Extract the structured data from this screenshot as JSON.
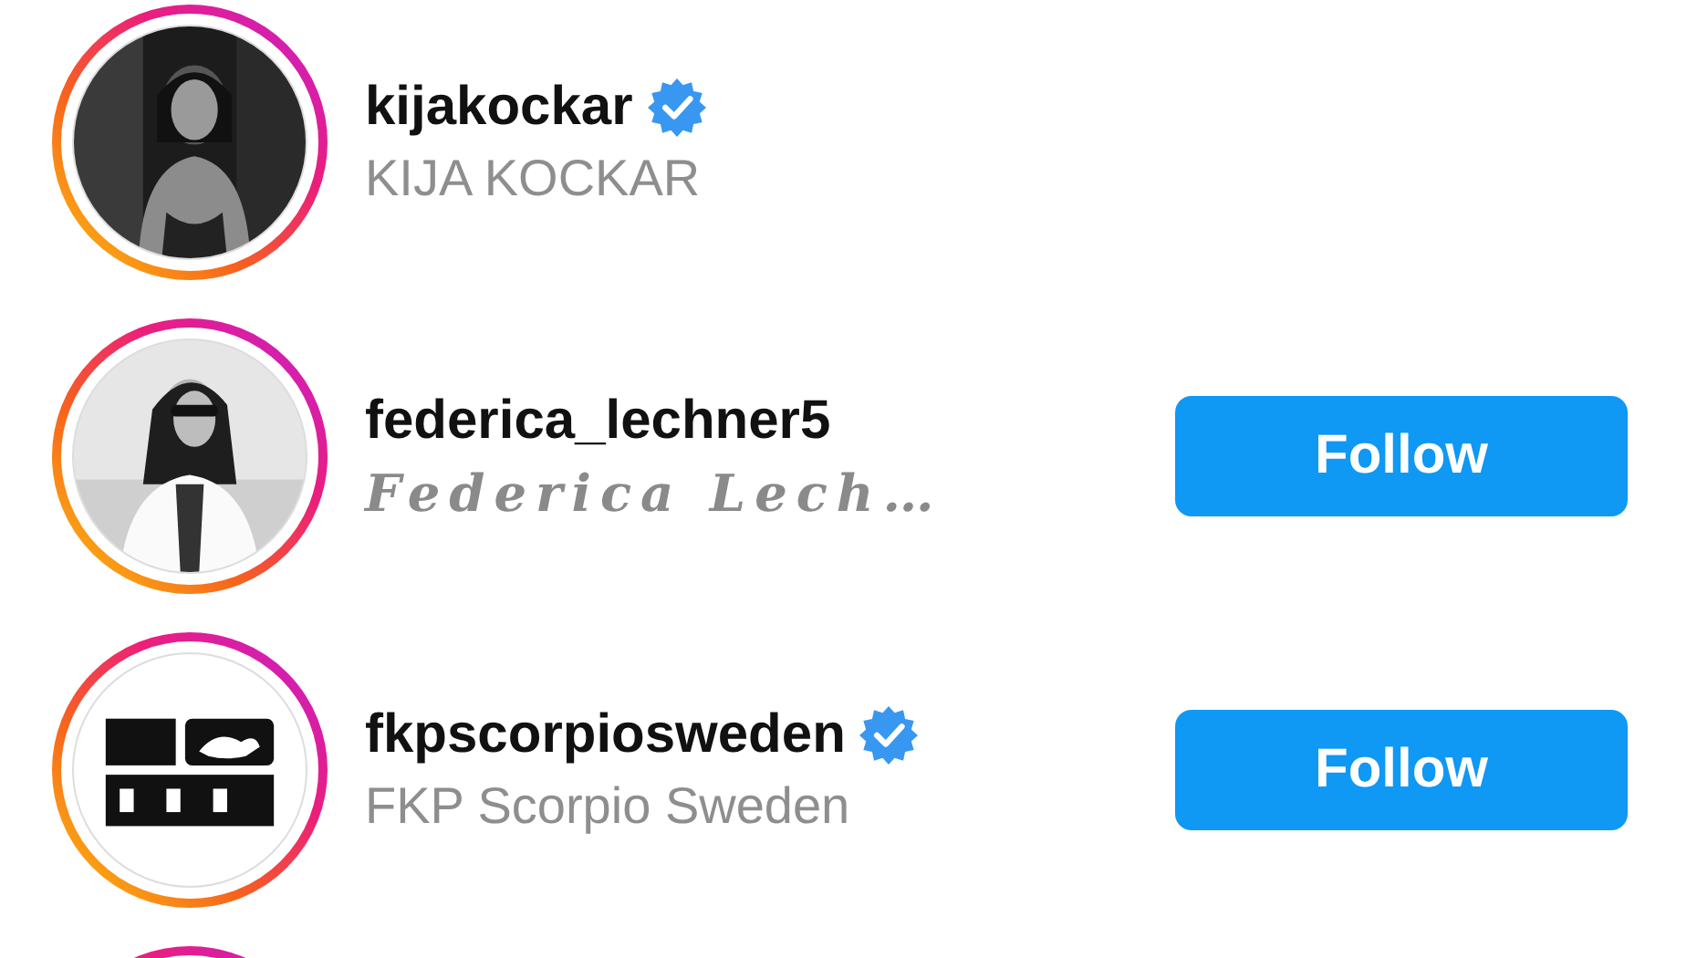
{
  "accounts": [
    {
      "kind": "full",
      "username": "kijakockar",
      "verified": true,
      "display_name": "KIJA KOCKAR",
      "fancy_font": false
    },
    {
      "kind": "full",
      "username": "federica_lechner5",
      "verified": false,
      "display_name": "Federica Lech…",
      "fancy_font": true,
      "follow_button": "Follow"
    },
    {
      "kind": "full",
      "username": "fkpscorpiosweden",
      "verified": true,
      "display_name": "FKP Scorpio Sweden",
      "fancy_font": false,
      "follow_button": "Follow"
    },
    {
      "kind": "cut"
    }
  ]
}
